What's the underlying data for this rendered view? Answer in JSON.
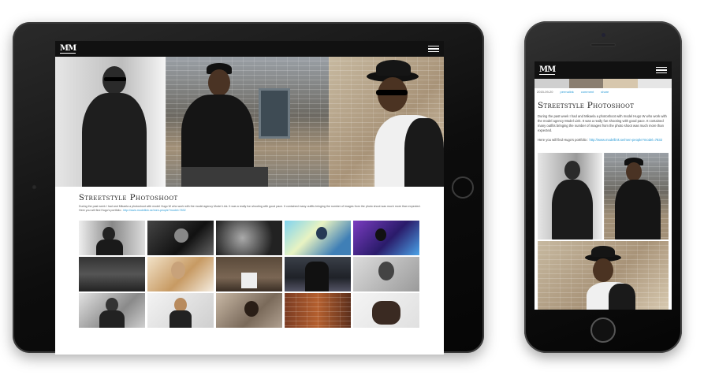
{
  "site": {
    "logo": "MM",
    "menu_icon": "hamburger-menu-icon"
  },
  "tablet": {
    "post_title": "Streetstyle Photoshoot",
    "post_body": "During the past week I had and Mikaela a photoshoot with model Hugo W who work with the model agency Model Link. It was a really fun shooting with good pace. It contained many outfits bringing the number of images from the photo shoot was much more than expected. Here you will find Hugo's portfolio :",
    "portfolio_link": "http://www.modellink.se/men-people?model=7832"
  },
  "phone": {
    "date": "2015-09-20",
    "meta_links": [
      "permalink",
      "comment",
      "share"
    ],
    "post_title": "Streetstyle Photoshoot",
    "post_body": "During the past week I had and Mikaela a photoshoot with model Hugo W who work with the model agency Model Link. It was a really fun shooting with good pace. It contained many outfits bringing the number of images from the photo shoot was much more than expected.",
    "portfolio_prefix": "Here you will find Hugo's portfolio :",
    "portfolio_link": "http://www.modellink.se/men-people?model=7832"
  },
  "colors": {
    "nav_background": "#111111",
    "link": "#2a9bd6",
    "device_frame": "#111111"
  }
}
